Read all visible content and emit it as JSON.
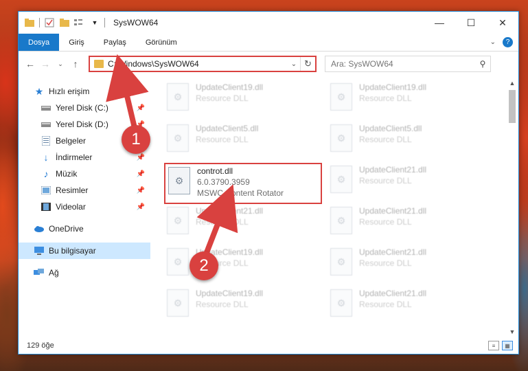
{
  "window": {
    "title": "SysWOW64",
    "controls": {
      "minimize": "—",
      "maximize": "☐",
      "close": "✕"
    }
  },
  "ribbon": {
    "tabs": [
      "Dosya",
      "Giriş",
      "Paylaş",
      "Görünüm"
    ]
  },
  "address": {
    "path": "C:\\Windows\\SysWOW64"
  },
  "search": {
    "placeholder": "Ara: SysWOW64"
  },
  "nav": {
    "quick_access": "Hızlı erişim",
    "items": [
      {
        "label": "Yerel Disk (C:)",
        "icon": "drive-icon"
      },
      {
        "label": "Yerel Disk (D:)",
        "icon": "drive-icon"
      },
      {
        "label": "Belgeler",
        "icon": "documents-icon"
      },
      {
        "label": "İndirmeler",
        "icon": "downloads-icon"
      },
      {
        "label": "Müzik",
        "icon": "music-icon"
      },
      {
        "label": "Resimler",
        "icon": "pictures-icon"
      },
      {
        "label": "Videolar",
        "icon": "videos-icon"
      }
    ],
    "onedrive": "OneDrive",
    "this_pc": "Bu bilgisayar",
    "network": "Ağ"
  },
  "files": [
    {
      "name": "UpdateClient19.dll",
      "sub": "Resource DLL",
      "blur": true
    },
    {
      "name": "UpdateClient19.dll",
      "sub": "Resource DLL",
      "blur": true
    },
    {
      "name": "UpdateClient5.dll",
      "sub": "Resource DLL",
      "blur": true
    },
    {
      "name": "UpdateClient5.dll",
      "sub": "Resource DLL",
      "blur": true
    },
    {
      "name": "controt.dll",
      "version": "6.0.3790.3959",
      "sub": "MSWC Content Rotator",
      "blur": false
    },
    {
      "name": "UpdateClient21.dll",
      "sub": "Resource DLL",
      "blur": true
    },
    {
      "name": "UpdateClient21.dll",
      "sub": "Resource DLL",
      "blur": true
    },
    {
      "name": "UpdateClient21.dll",
      "sub": "Resource DLL",
      "blur": true
    },
    {
      "name": "UpdateClient19.dll",
      "sub": "Resource DLL",
      "blur": true
    },
    {
      "name": "UpdateClient21.dll",
      "sub": "Resource DLL",
      "blur": true
    },
    {
      "name": "UpdateClient19.dll",
      "sub": "Resource DLL",
      "blur": true
    },
    {
      "name": "UpdateClient21.dll",
      "sub": "Resource DLL",
      "blur": true
    }
  ],
  "status": {
    "count": "129 öğe"
  },
  "annotations": {
    "step1": "1",
    "step2": "2"
  },
  "colors": {
    "accent": "#1979ca",
    "highlight": "#d9413f"
  }
}
